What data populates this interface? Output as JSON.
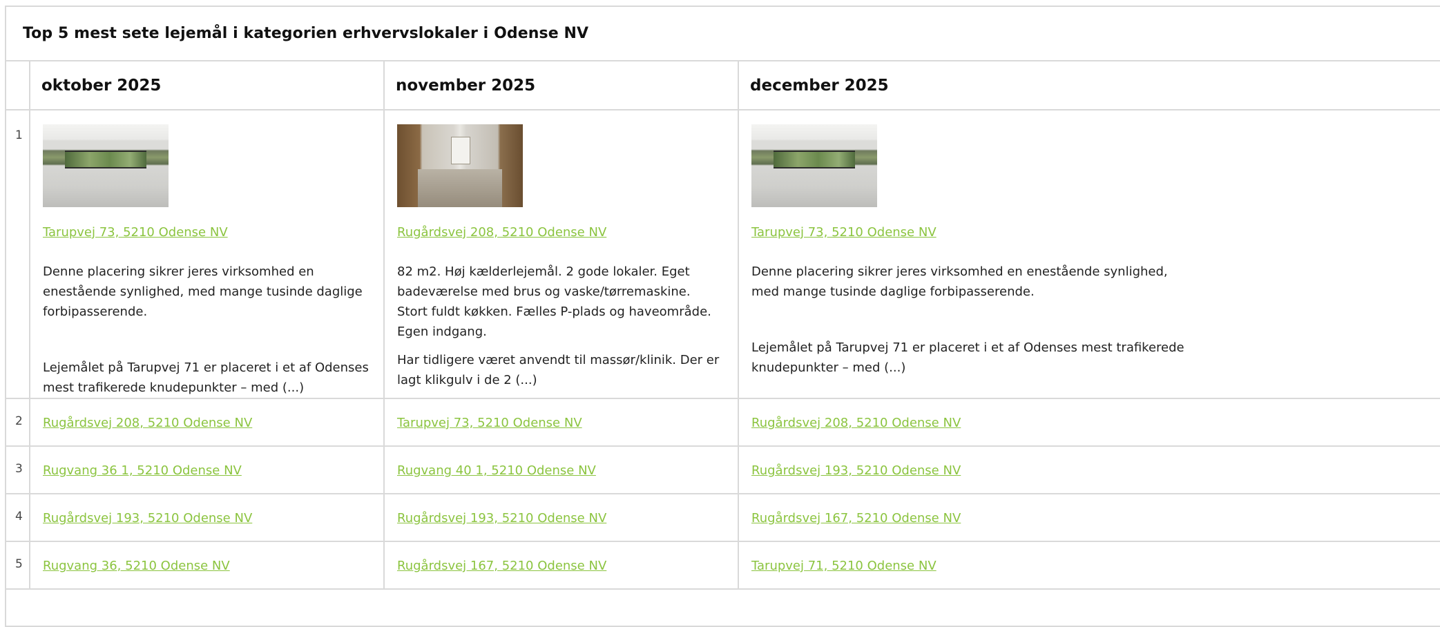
{
  "title": "Top 5 mest sete lejemål i kategorien erhvervslokaler i Odense NV",
  "months": [
    "oktober 2025",
    "november 2025",
    "december 2025"
  ],
  "top": [
    {
      "address": "Tarupvej 73, 5210 Odense NV",
      "image": "bright-empty-hall-photo",
      "paragraphs": [
        "Denne placering sikrer jeres virksomhed en enestående synlighed, med mange tusinde daglige forbipasserende.",
        "Lejemålet på Tarupvej 71 er placeret i et af Odenses mest trafikerede knudepunkter – med (...)"
      ]
    },
    {
      "address": "Rugårdsvej 208, 5210 Odense NV",
      "image": "corridor-photo",
      "paragraphs": [
        "82 m2. Høj kælderlejemål. 2 gode lokaler. Eget badeværelse med brus og vaske/tørremaskine. Stort fuldt køkken. Fælles P-plads og haveområde. Egen indgang.",
        "Har tidligere været anvendt til massør/klinik. Der er lagt klikgulv i de 2 (...)"
      ]
    },
    {
      "address": "Tarupvej 73, 5210 Odense NV",
      "image": "bright-empty-hall-photo",
      "paragraphs": [
        "Denne placering sikrer jeres virksomhed en enestående synlighed, med mange tusinde daglige forbipasserende.",
        "Lejemålet på Tarupvej 71 er placeret i et af Odenses mest trafikerede knudepunkter – med (...)"
      ]
    }
  ],
  "rows": [
    {
      "rank": "1"
    },
    {
      "rank": "2",
      "cols": [
        "Rugårdsvej 208, 5210 Odense NV",
        "Tarupvej 73, 5210 Odense NV",
        "Rugårdsvej 208, 5210 Odense NV"
      ]
    },
    {
      "rank": "3",
      "cols": [
        "Rugvang 36 1, 5210 Odense NV",
        "Rugvang 40 1, 5210 Odense NV",
        "Rugårdsvej 193, 5210 Odense NV"
      ]
    },
    {
      "rank": "4",
      "cols": [
        "Rugårdsvej 193, 5210 Odense NV",
        "Rugårdsvej 193, 5210 Odense NV",
        "Rugårdsvej 167, 5210 Odense NV"
      ]
    },
    {
      "rank": "5",
      "cols": [
        "Rugvang 36, 5210 Odense NV",
        "Rugårdsvej 167, 5210 Odense NV",
        "Tarupvej 71, 5210 Odense NV"
      ]
    }
  ],
  "colors": {
    "link": "#8bc43f",
    "border": "#d9d9d9"
  }
}
